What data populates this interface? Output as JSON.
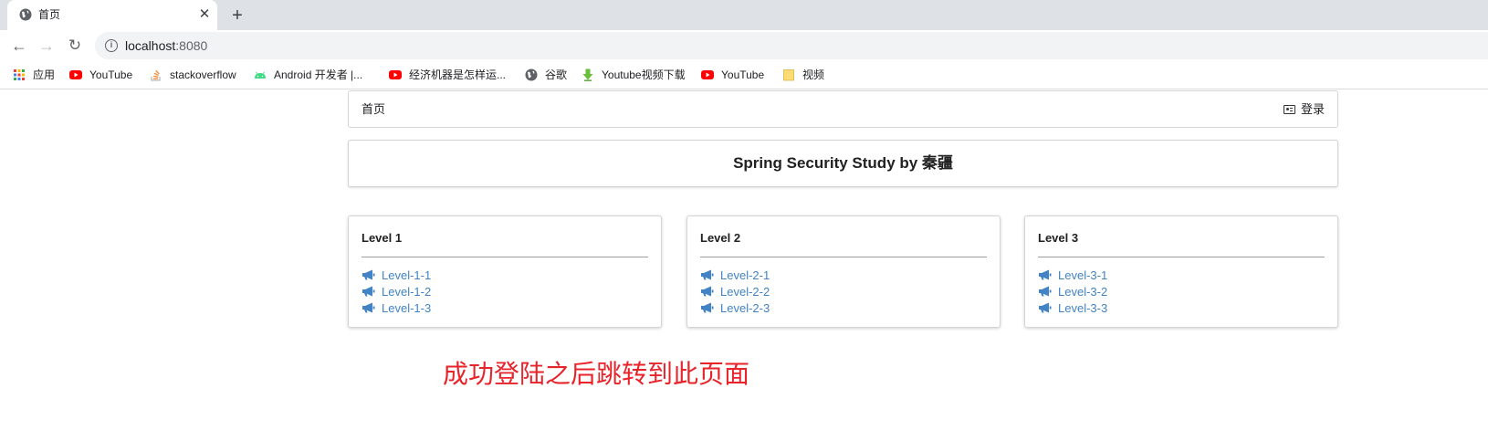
{
  "browser": {
    "tab": {
      "title": "首页",
      "close_glyph": "✕"
    },
    "new_tab_glyph": "+",
    "nav": {
      "back_glyph": "←",
      "forward_glyph": "→",
      "reload_glyph": "↻"
    },
    "address": {
      "host": "localhost",
      "port": ":8080",
      "info_glyph": "i"
    },
    "bookmarks": [
      {
        "label": "应用",
        "icon": "apps-grid-icon"
      },
      {
        "label": "YouTube",
        "icon": "youtube-icon"
      },
      {
        "label": "stackoverflow",
        "icon": "stackoverflow-icon"
      },
      {
        "label": "Android 开发者  |...",
        "icon": "android-icon"
      },
      {
        "label": "经济机器是怎样运...",
        "icon": "youtube-icon"
      },
      {
        "label": "谷歌",
        "icon": "globe-icon"
      },
      {
        "label": "Youtube视频下载",
        "icon": "download-icon"
      },
      {
        "label": "YouTube",
        "icon": "youtube-icon"
      },
      {
        "label": "视频",
        "icon": "folder-icon"
      }
    ]
  },
  "page": {
    "menu": {
      "home": "首页",
      "login": "登录"
    },
    "title": "Spring Security Study by 秦疆",
    "cards": [
      {
        "title": "Level 1",
        "links": [
          "Level-1-1",
          "Level-1-2",
          "Level-1-3"
        ]
      },
      {
        "title": "Level 2",
        "links": [
          "Level-2-1",
          "Level-2-2",
          "Level-2-3"
        ]
      },
      {
        "title": "Level 3",
        "links": [
          "Level-3-1",
          "Level-3-2",
          "Level-3-3"
        ]
      }
    ],
    "caption": "成功登陆之后跳转到此页面"
  },
  "colors": {
    "tabstrip_bg": "#dee1e6",
    "omnibox_bg": "#f1f3f4",
    "link": "#4183c4",
    "caption": "#e8232a",
    "youtube_red": "#ff0000"
  }
}
